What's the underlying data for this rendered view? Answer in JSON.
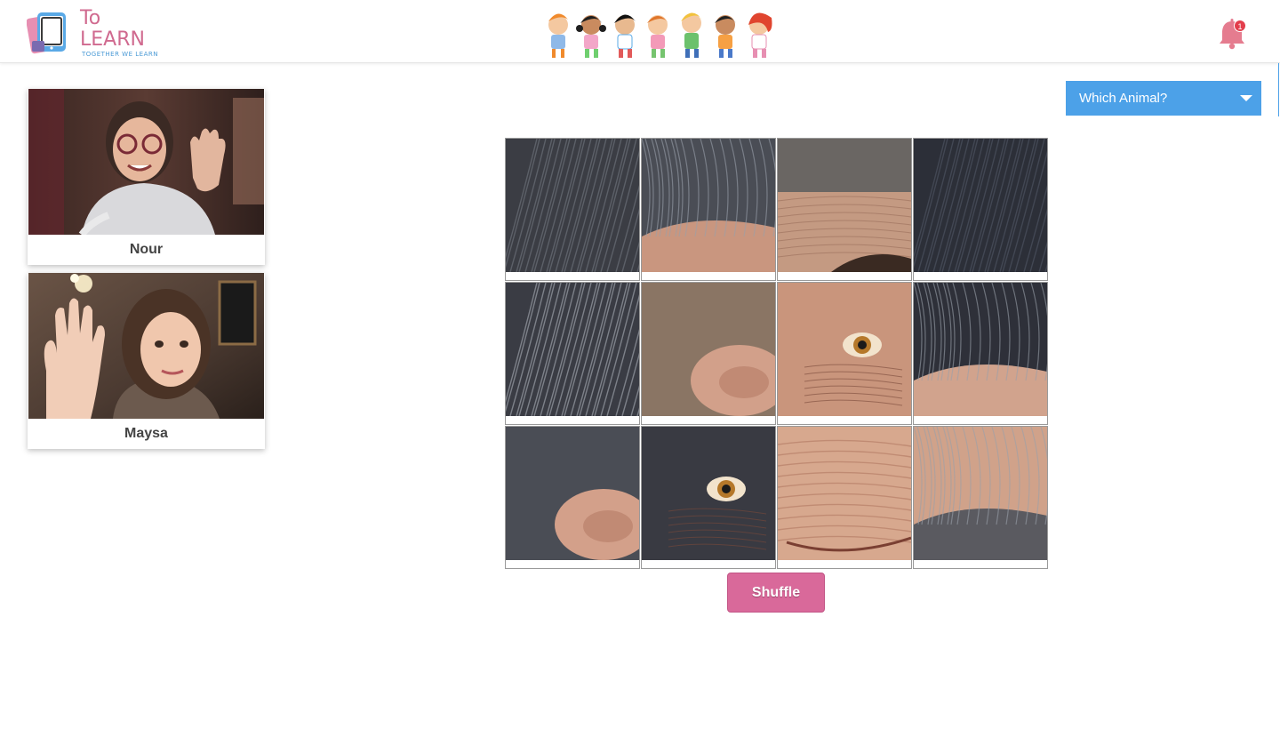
{
  "header": {
    "logo_title": "To LEARN",
    "logo_subtitle": "TOGETHER WE LEARN",
    "notification_count": "1",
    "icons": [
      "tablet-logo-icon",
      "kids-banner-illustration",
      "bell-icon"
    ]
  },
  "participants": [
    {
      "name": "Nour"
    },
    {
      "name": "Maysa"
    }
  ],
  "game": {
    "selector_label": "Which Animal?",
    "shuffle_label": "Shuffle",
    "grid_rows": 3,
    "grid_cols": 4
  },
  "colors": {
    "brand_pink": "#d9699a",
    "brand_blue": "#4ca1e8",
    "badge_red": "#e33e4c"
  }
}
